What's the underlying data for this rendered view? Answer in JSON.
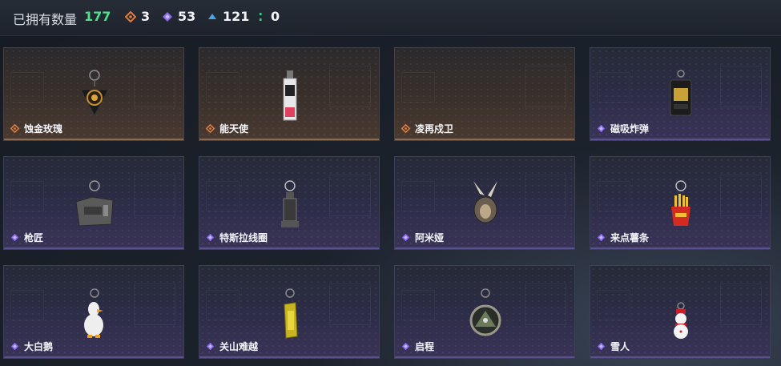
{
  "header": {
    "title": "已拥有数量",
    "total": "177",
    "stats": [
      {
        "icon": "orange-rarity-icon",
        "value": "3",
        "color": "#e07a3a"
      },
      {
        "icon": "purple-rarity-icon",
        "value": "53",
        "color": "#8a6de8"
      },
      {
        "icon": "blue-rarity-icon",
        "value": "121",
        "color": "#4aa3e8"
      },
      {
        "icon": "green-rarity-icon",
        "value": "0",
        "color": "#3fd18a"
      }
    ]
  },
  "items": [
    {
      "name": "蚀金玫瑰",
      "rarity": "orange"
    },
    {
      "name": "能天使",
      "rarity": "orange"
    },
    {
      "name": "凌再戍卫",
      "rarity": "orange"
    },
    {
      "name": "磁吸炸弹",
      "rarity": "purple"
    },
    {
      "name": "枪匠",
      "rarity": "purple"
    },
    {
      "name": "特斯拉线圈",
      "rarity": "purple"
    },
    {
      "name": "阿米娅",
      "rarity": "purple"
    },
    {
      "name": "来点薯条",
      "rarity": "purple"
    },
    {
      "name": "大白鹅",
      "rarity": "purple"
    },
    {
      "name": "关山难越",
      "rarity": "purple"
    },
    {
      "name": "启程",
      "rarity": "purple"
    },
    {
      "name": "雪人",
      "rarity": "purple"
    }
  ],
  "colors": {
    "orange": "#e07a3a",
    "purple": "#8a6de8",
    "count": "#4fe08a"
  }
}
